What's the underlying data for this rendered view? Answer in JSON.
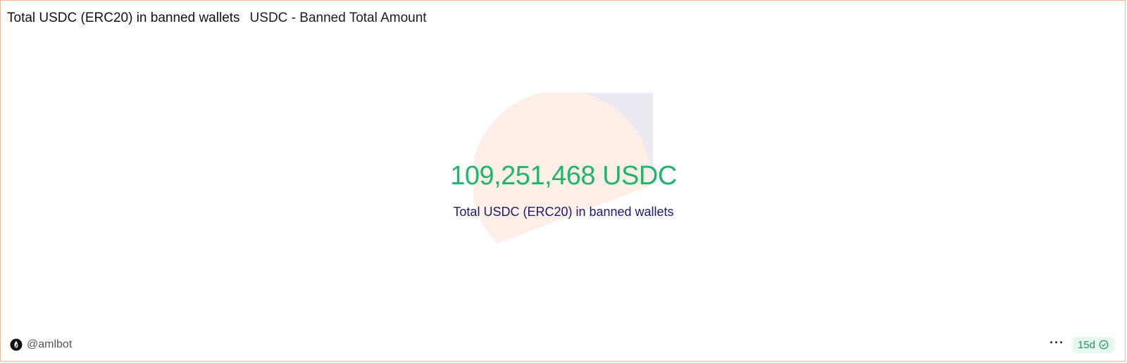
{
  "header": {
    "title": "Total USDC (ERC20) in banned wallets",
    "subtitle": "USDC - Banned Total Amount"
  },
  "counter": {
    "value": "109,251,468 USDC",
    "label": "Total USDC (ERC20) in banned wallets"
  },
  "footer": {
    "owner": "@amlbot",
    "more_label": "···",
    "age": "15d"
  },
  "icons": {
    "owner": "dune-logo-icon",
    "more": "more-icon",
    "freshness": "check-circle-icon"
  },
  "colors": {
    "border": "#f2b79f",
    "counter_value": "#1fb56b",
    "counter_label": "#1b1a6d",
    "circle_top": "#fdefe8",
    "circle_bottom": "#ebeaf3",
    "badge_bg": "#e6f7ee",
    "badge_text": "#1a9a5a"
  }
}
